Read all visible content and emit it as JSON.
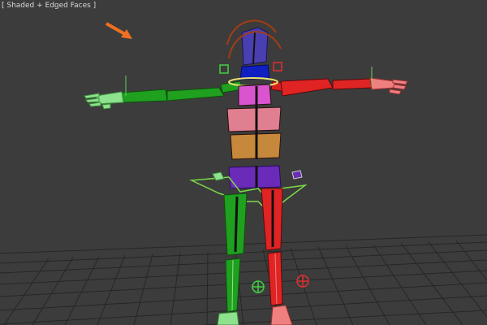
{
  "viewport": {
    "label": "[ Shaded + Edged Faces ]",
    "background": "#3c3c3c",
    "grid_color": "#2a2a2a"
  },
  "scene": {
    "object": "biped-rig",
    "colors": {
      "left_side": "#1fa01f",
      "right_side": "#d81e1e",
      "head": "#4a3fb0",
      "pelvis": "#6a2bb8",
      "spine_upper": "#e07f8f",
      "spine_mid": "#e88aa0",
      "spine_lower": "#c6883a",
      "neck": "#1020c0",
      "selection_highlight": "#c8ff7a",
      "rotation_gizmo": "#a23c14",
      "arrow": "#f07020"
    },
    "icons": [
      "orange-arrow-icon",
      "rotation-gizmo-icon",
      "ik-target-icon"
    ]
  }
}
